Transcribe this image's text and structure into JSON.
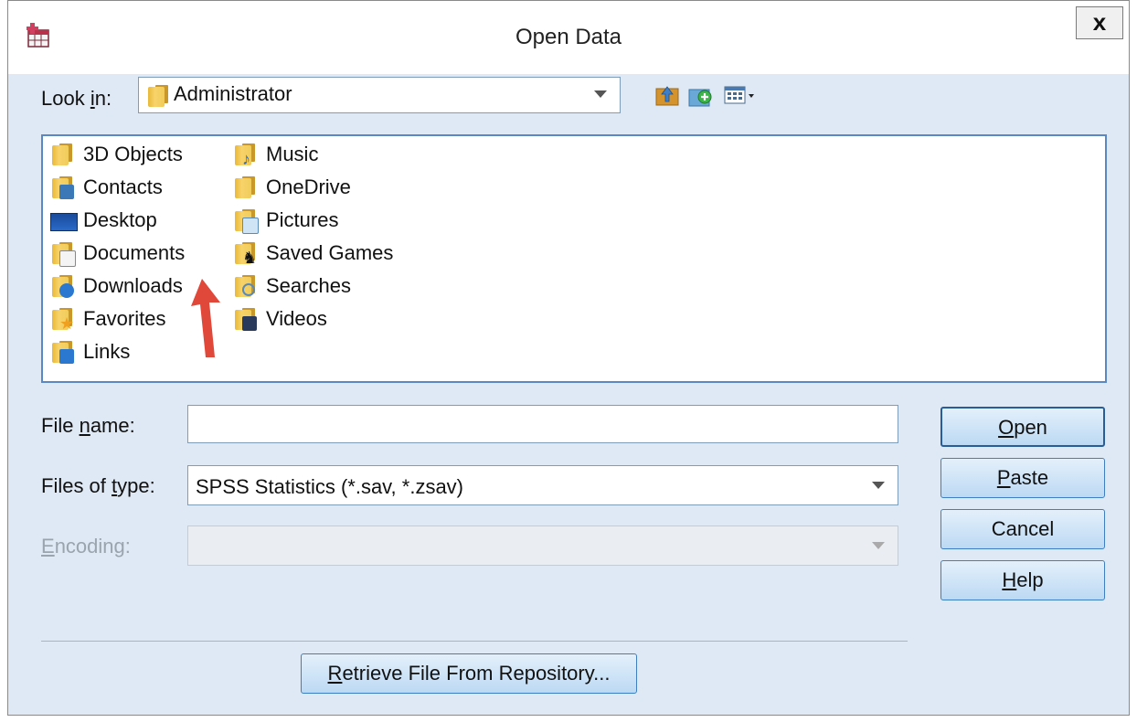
{
  "window": {
    "title": "Open Data",
    "close_label": "x"
  },
  "look_in": {
    "label_pre": "Look ",
    "label_u": "i",
    "label_post": "n:",
    "value": "Administrator"
  },
  "toolbar": {
    "icons": [
      "up-folder-icon",
      "new-folder-icon",
      "view-menu-icon"
    ]
  },
  "files": [
    {
      "name": "3D Objects",
      "icon": "folder-icon"
    },
    {
      "name": "Contacts",
      "icon": "contacts-folder-icon"
    },
    {
      "name": "Desktop",
      "icon": "desktop-icon"
    },
    {
      "name": "Documents",
      "icon": "documents-icon"
    },
    {
      "name": "Downloads",
      "icon": "downloads-folder-icon"
    },
    {
      "name": "Favorites",
      "icon": "favorites-folder-icon"
    },
    {
      "name": "Links",
      "icon": "links-folder-icon"
    },
    {
      "name": "Music",
      "icon": "music-folder-icon"
    },
    {
      "name": "OneDrive",
      "icon": "folder-icon"
    },
    {
      "name": "Pictures",
      "icon": "pictures-folder-icon"
    },
    {
      "name": "Saved Games",
      "icon": "saved-games-folder-icon"
    },
    {
      "name": "Searches",
      "icon": "searches-folder-icon"
    },
    {
      "name": "Videos",
      "icon": "videos-folder-icon"
    }
  ],
  "file_name": {
    "label_pre": "File ",
    "label_u": "n",
    "label_post": "ame:",
    "value": ""
  },
  "files_of_type": {
    "label_pre": "Files of ",
    "label_u": "t",
    "label_post": "ype:",
    "value": "SPSS Statistics (*.sav, *.zsav)"
  },
  "encoding": {
    "label_pre": "",
    "label_u": "E",
    "label_post": "ncoding:",
    "value": ""
  },
  "buttons": {
    "open": {
      "u": "O",
      "rest": "pen"
    },
    "paste": {
      "u": "P",
      "rest": "aste"
    },
    "cancel": {
      "label": "Cancel"
    },
    "help": {
      "u": "H",
      "rest": "elp"
    },
    "retrieve": {
      "u": "R",
      "rest": "etrieve File From Repository..."
    }
  },
  "colors": {
    "accent": "#3f7fbf",
    "window_bg": "#dfe9f5",
    "annotation_arrow": "#e0483a"
  }
}
